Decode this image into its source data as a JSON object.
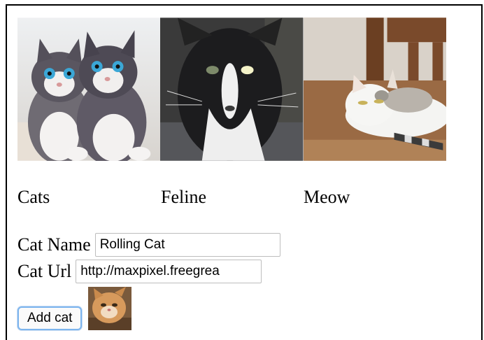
{
  "gallery": {
    "photos": [
      {
        "caption": "Cats",
        "icon": "kittens-photo"
      },
      {
        "caption": "Feline",
        "icon": "black-white-cat-photo"
      },
      {
        "caption": "Meow",
        "icon": "lying-cat-photo"
      }
    ]
  },
  "form": {
    "name_label": "Cat Name",
    "name_value": "Rolling Cat",
    "url_label": "Cat Url",
    "url_value": "http://maxpixel.freegrea",
    "add_button": "Add cat"
  },
  "preview": {
    "icon": "rolling-cat-thumbnail"
  }
}
